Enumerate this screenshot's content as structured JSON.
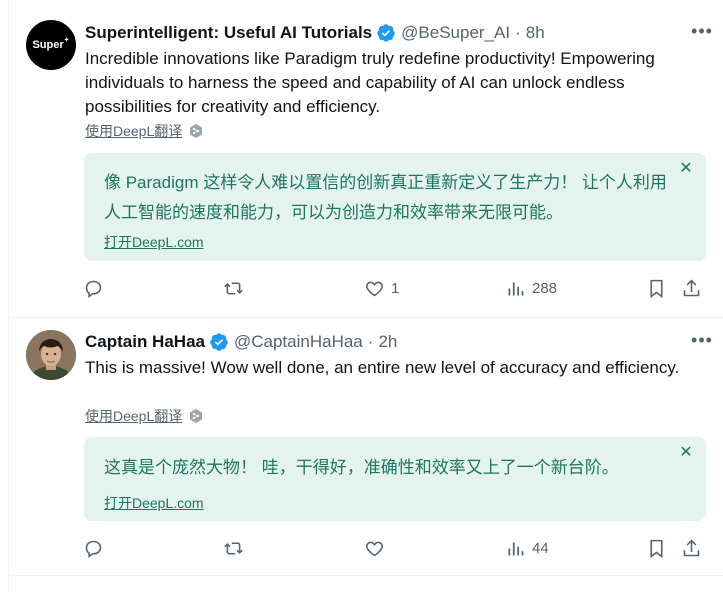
{
  "tweets": [
    {
      "avatar_text": "Super",
      "name": "Superintelligent: Useful AI Tutorials",
      "handle": "@BeSuper_AI",
      "dot": "·",
      "time": "8h",
      "text": "Incredible innovations like Paradigm truly redefine productivity! Empowering individuals to harness the speed and capability of AI can unlock endless possibilities for creativity and efficiency.",
      "deepl_label": "使用DeepL翻译",
      "translation": "像 Paradigm 这样令人难以置信的创新真正重新定义了生产力！ 让个人利用人工智能的速度和能力，可以为创造力和效率带来无限可能。",
      "open_deepl": "打开DeepL.com",
      "replies": "",
      "retweets": "",
      "likes": "1",
      "views": "288"
    },
    {
      "name": "Captain HaHaa",
      "handle": "@CaptainHaHaa",
      "dot": "·",
      "time": "2h",
      "text": "This is massive! Wow well done, an entire new level of accuracy and efficiency.",
      "deepl_label": "使用DeepL翻译",
      "translation": "这真是个庞然大物！ 哇，干得好，准确性和效率又上了一个新台阶。",
      "open_deepl": "打开DeepL.com",
      "replies": "",
      "retweets": "",
      "likes": "",
      "views": "44"
    }
  ],
  "colors": {
    "verified": "#1d9bf0",
    "translation_bg": "#e5f3ef",
    "translation_text": "#1d7562",
    "secondary_text": "#536471"
  },
  "icons": [
    "more-icon",
    "verified-badge-icon",
    "deepl-icon",
    "close-icon",
    "reply-icon",
    "retweet-icon",
    "like-icon",
    "views-icon",
    "bookmark-icon",
    "share-icon"
  ]
}
